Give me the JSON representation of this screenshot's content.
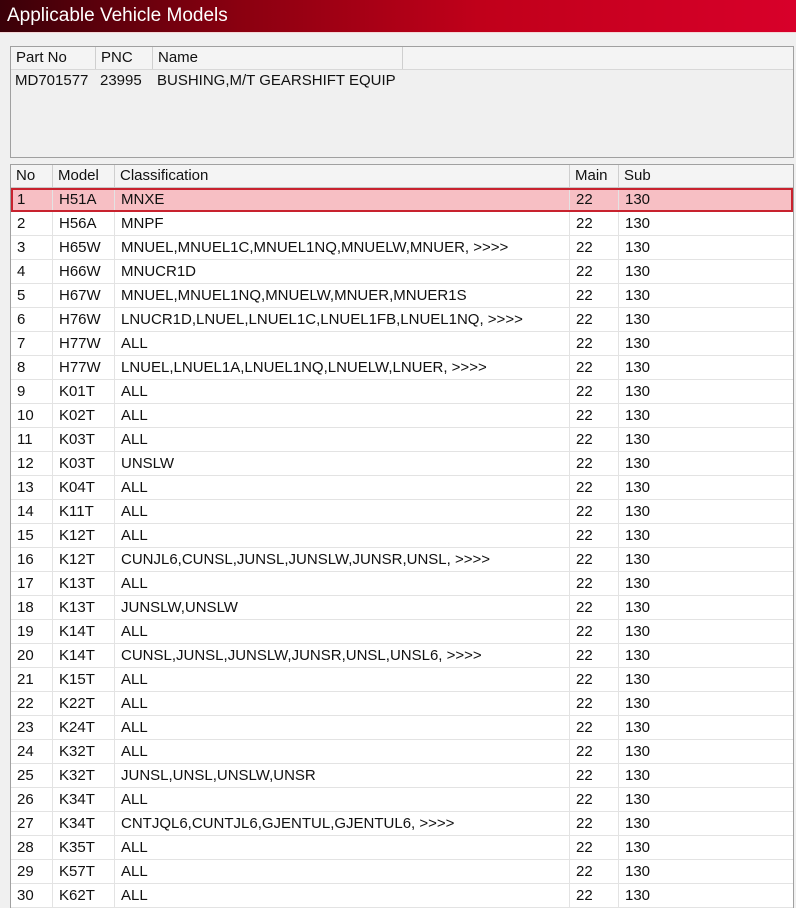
{
  "window": {
    "title": "Applicable Vehicle Models"
  },
  "part_panel": {
    "columns": [
      "Part No",
      "PNC",
      "Name"
    ],
    "row": {
      "part_no": "MD701577",
      "pnc": "23995",
      "name": "BUSHING,M/T GEARSHIFT EQUIP"
    }
  },
  "grid": {
    "columns": [
      "No",
      "Model",
      "Classification",
      "Main",
      "Sub"
    ],
    "selected_row": 1,
    "rows": [
      {
        "no": "1",
        "model": "H51A",
        "classification": "MNXE",
        "main": "22",
        "sub": "130"
      },
      {
        "no": "2",
        "model": "H56A",
        "classification": "MNPF",
        "main": "22",
        "sub": "130"
      },
      {
        "no": "3",
        "model": "H65W",
        "classification": "MNUEL,MNUEL1C,MNUEL1NQ,MNUELW,MNUER,  >>>>",
        "main": "22",
        "sub": "130"
      },
      {
        "no": "4",
        "model": "H66W",
        "classification": "MNUCR1D",
        "main": "22",
        "sub": "130"
      },
      {
        "no": "5",
        "model": "H67W",
        "classification": "MNUEL,MNUEL1NQ,MNUELW,MNUER,MNUER1S",
        "main": "22",
        "sub": "130"
      },
      {
        "no": "6",
        "model": "H76W",
        "classification": "LNUCR1D,LNUEL,LNUEL1C,LNUEL1FB,LNUEL1NQ,  >>>>",
        "main": "22",
        "sub": "130"
      },
      {
        "no": "7",
        "model": "H77W",
        "classification": "ALL",
        "main": "22",
        "sub": "130"
      },
      {
        "no": "8",
        "model": "H77W",
        "classification": "LNUEL,LNUEL1A,LNUEL1NQ,LNUELW,LNUER,  >>>>",
        "main": "22",
        "sub": "130"
      },
      {
        "no": "9",
        "model": "K01T",
        "classification": "ALL",
        "main": "22",
        "sub": "130"
      },
      {
        "no": "10",
        "model": "K02T",
        "classification": "ALL",
        "main": "22",
        "sub": "130"
      },
      {
        "no": "11",
        "model": "K03T",
        "classification": "ALL",
        "main": "22",
        "sub": "130"
      },
      {
        "no": "12",
        "model": "K03T",
        "classification": "UNSLW",
        "main": "22",
        "sub": "130"
      },
      {
        "no": "13",
        "model": "K04T",
        "classification": "ALL",
        "main": "22",
        "sub": "130"
      },
      {
        "no": "14",
        "model": "K11T",
        "classification": "ALL",
        "main": "22",
        "sub": "130"
      },
      {
        "no": "15",
        "model": "K12T",
        "classification": "ALL",
        "main": "22",
        "sub": "130"
      },
      {
        "no": "16",
        "model": "K12T",
        "classification": "CUNJL6,CUNSL,JUNSL,JUNSLW,JUNSR,UNSL,  >>>>",
        "main": "22",
        "sub": "130"
      },
      {
        "no": "17",
        "model": "K13T",
        "classification": "ALL",
        "main": "22",
        "sub": "130"
      },
      {
        "no": "18",
        "model": "K13T",
        "classification": "JUNSLW,UNSLW",
        "main": "22",
        "sub": "130"
      },
      {
        "no": "19",
        "model": "K14T",
        "classification": "ALL",
        "main": "22",
        "sub": "130"
      },
      {
        "no": "20",
        "model": "K14T",
        "classification": "CUNSL,JUNSL,JUNSLW,JUNSR,UNSL,UNSL6,  >>>>",
        "main": "22",
        "sub": "130"
      },
      {
        "no": "21",
        "model": "K15T",
        "classification": "ALL",
        "main": "22",
        "sub": "130"
      },
      {
        "no": "22",
        "model": "K22T",
        "classification": "ALL",
        "main": "22",
        "sub": "130"
      },
      {
        "no": "23",
        "model": "K24T",
        "classification": "ALL",
        "main": "22",
        "sub": "130"
      },
      {
        "no": "24",
        "model": "K32T",
        "classification": "ALL",
        "main": "22",
        "sub": "130"
      },
      {
        "no": "25",
        "model": "K32T",
        "classification": "JUNSL,UNSL,UNSLW,UNSR",
        "main": "22",
        "sub": "130"
      },
      {
        "no": "26",
        "model": "K34T",
        "classification": "ALL",
        "main": "22",
        "sub": "130"
      },
      {
        "no": "27",
        "model": "K34T",
        "classification": "CNTJQL6,CUNTJL6,GJENTUL,GJENTUL6,  >>>>",
        "main": "22",
        "sub": "130"
      },
      {
        "no": "28",
        "model": "K35T",
        "classification": "ALL",
        "main": "22",
        "sub": "130"
      },
      {
        "no": "29",
        "model": "K57T",
        "classification": "ALL",
        "main": "22",
        "sub": "130"
      },
      {
        "no": "30",
        "model": "K62T",
        "classification": "ALL",
        "main": "22",
        "sub": "130"
      }
    ]
  }
}
